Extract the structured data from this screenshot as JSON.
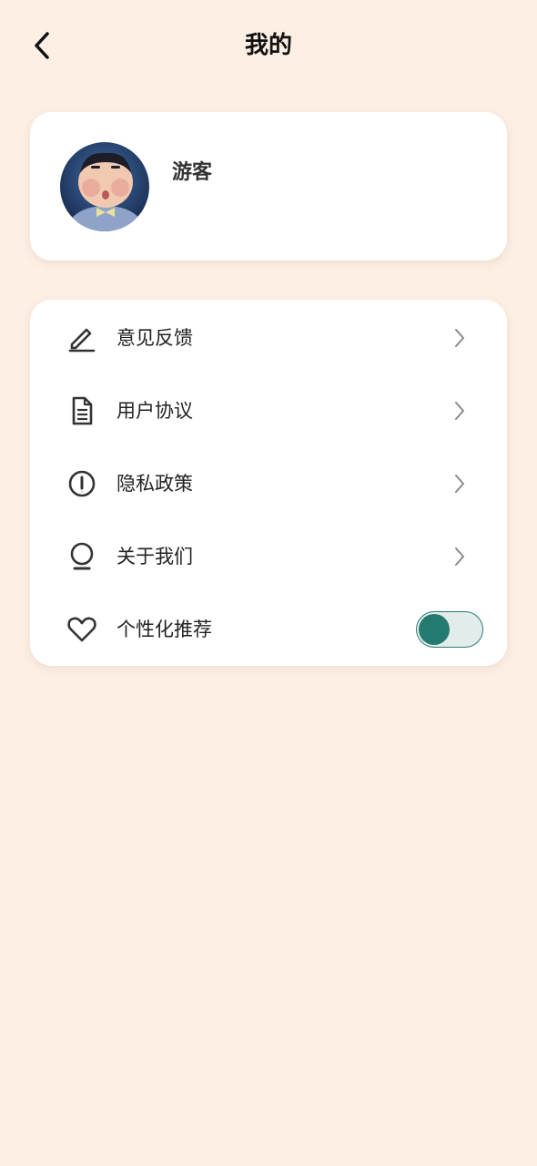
{
  "header": {
    "title": "我的",
    "back_icon": "chevron-left-icon"
  },
  "profile": {
    "username": "游客",
    "avatar": "cartoon-boy-avatar"
  },
  "menu": {
    "items": [
      {
        "label": "意见反馈",
        "icon": "pen-icon"
      },
      {
        "label": "用户协议",
        "icon": "document-icon"
      },
      {
        "label": "隐私政策",
        "icon": "info-circle-icon"
      },
      {
        "label": "关于我们",
        "icon": "about-icon"
      },
      {
        "label": "个性化推荐",
        "icon": "heart-icon"
      }
    ],
    "personalized_recommendation_enabled": true
  },
  "colors": {
    "background": "#fdefe4",
    "card": "#ffffff",
    "accent": "#257a70",
    "toggle_track": "#e2ecea"
  }
}
